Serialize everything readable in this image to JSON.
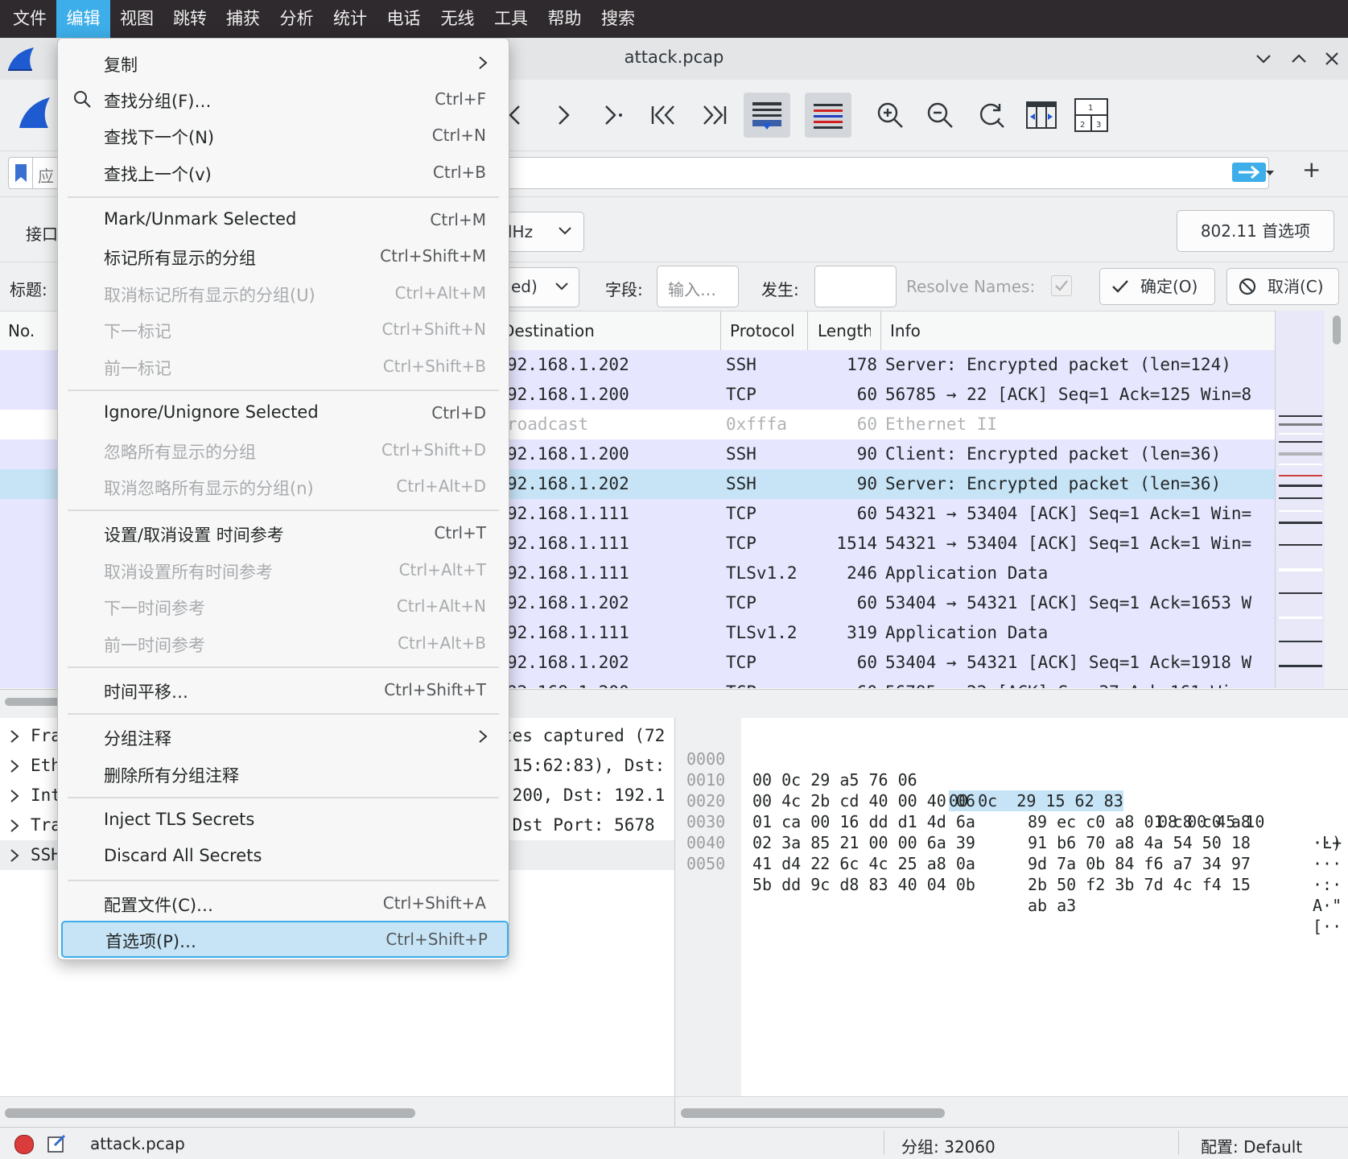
{
  "menubar": {
    "items": [
      "文件",
      "编辑",
      "视图",
      "跳转",
      "捕获",
      "分析",
      "统计",
      "电话",
      "无线",
      "工具",
      "帮助",
      "搜索"
    ]
  },
  "window": {
    "title": "attack.pcap"
  },
  "filter": {
    "left_label": "应"
  },
  "wireless": {
    "left_label": "接口",
    "channel_value": "lHz",
    "prefs_button": "802.11 首选项"
  },
  "column_prefs": {
    "title_label": "标题:",
    "type_value": "ed)",
    "field_label": "字段:",
    "field_placeholder": "输入…",
    "occurrence_label": "发生:",
    "resolve_label": "Resolve Names:",
    "ok_label": "确定(O)",
    "cancel_label": "取消(C)"
  },
  "packet_list": {
    "columns": {
      "no": "No.",
      "destination": "Destination",
      "protocol": "Protocol",
      "length": "Length",
      "info": "Info"
    },
    "rows": [
      {
        "dest": "92.168.1.202",
        "proto": "SSH",
        "len": "178",
        "info": "Server: Encrypted packet (len=124)"
      },
      {
        "dest": "92.168.1.200",
        "proto": "TCP",
        "len": "60",
        "info": "56785 → 22 [ACK] Seq=1 Ack=125 Win=8"
      },
      {
        "dest": "roadcast",
        "proto": "0xfffa",
        "len": "60",
        "info": "Ethernet II"
      },
      {
        "dest": "92.168.1.200",
        "proto": "SSH",
        "len": "90",
        "info": "Client: Encrypted packet (len=36)"
      },
      {
        "dest": "92.168.1.202",
        "proto": "SSH",
        "len": "90",
        "info": "Server: Encrypted packet (len=36)"
      },
      {
        "dest": "92.168.1.111",
        "proto": "TCP",
        "len": "60",
        "info": "54321 → 53404 [ACK] Seq=1 Ack=1 Win="
      },
      {
        "dest": "92.168.1.111",
        "proto": "TCP",
        "len": "1514",
        "info": "54321 → 53404 [ACK] Seq=1 Ack=1 Win="
      },
      {
        "dest": "92.168.1.111",
        "proto": "TLSv1.2",
        "len": "246",
        "info": "Application Data"
      },
      {
        "dest": "92.168.1.202",
        "proto": "TCP",
        "len": "60",
        "info": "53404 → 54321 [ACK] Seq=1 Ack=1653 W"
      },
      {
        "dest": "92.168.1.111",
        "proto": "TLSv1.2",
        "len": "319",
        "info": "Application Data"
      },
      {
        "dest": "92.168.1.202",
        "proto": "TCP",
        "len": "60",
        "info": "53404 → 54321 [ACK] Seq=1 Ack=1918 W"
      },
      {
        "dest": "92.168.1.200",
        "proto": "TCP",
        "len": "60",
        "info": "56785 → 22 [ACK] Seq=37 Ack=161 Win="
      }
    ]
  },
  "details": {
    "rows": [
      {
        "label": "Fra",
        "tail": "tes captured (72"
      },
      {
        "label": "Eth",
        "tail": ":15:62:83), Dst:"
      },
      {
        "label": "Int",
        "tail": ".200, Dst: 192.1"
      },
      {
        "label": "Tra",
        "tail": " Dst Port: 5678"
      },
      {
        "label": "SSH",
        "tail": ""
      }
    ]
  },
  "bytes": {
    "rows": [
      {
        "offset": "0000",
        "hex_a": "00 0c 29 a5 76 06",
        "hex_sel": "00 0c  29 15 62 83",
        "hex_b": "08 00 45 10",
        "ascii": "··)"
      },
      {
        "offset": "0010",
        "hex_a": "00 4c 2b cd 40 00 40 06",
        "hex_sel": "",
        "hex_b": "89 ec c0 a8 01 c8 c0 a8",
        "ascii": "·L+"
      },
      {
        "offset": "0020",
        "hex_a": "01 ca 00 16 dd d1 4d 6a",
        "hex_sel": "",
        "hex_b": "91 b6 70 a8 4a 54 50 18",
        "ascii": "···"
      },
      {
        "offset": "0030",
        "hex_a": "02 3a 85 21 00 00 6a 39",
        "hex_sel": "",
        "hex_b": "9d 7a 0b 84 f6 a7 34 97",
        "ascii": "·:·"
      },
      {
        "offset": "0040",
        "hex_a": "41 d4 22 6c 4c 25 a8 0a",
        "hex_sel": "",
        "hex_b": "2b 50 f2 3b 7d 4c f4 15",
        "ascii": "A·\""
      },
      {
        "offset": "0050",
        "hex_a": "5b dd 9c d8 83 40 04 0b",
        "hex_sel": "",
        "hex_b": "ab a3",
        "ascii": "[··"
      }
    ]
  },
  "status": {
    "file": "attack.pcap",
    "packets": "分组: 32060",
    "profile": "配置: Default"
  },
  "edit_menu": {
    "copy": "复制",
    "find_packet": "查找分组(F)…",
    "find_packet_sc": "Ctrl+F",
    "find_next": "查找下一个(N)",
    "find_next_sc": "Ctrl+N",
    "find_prev": "查找上一个(v)",
    "find_prev_sc": "Ctrl+B",
    "mark": "Mark/Unmark Selected",
    "mark_sc": "Ctrl+M",
    "mark_all": "标记所有显示的分组",
    "mark_all_sc": "Ctrl+Shift+M",
    "unmark_all": "取消标记所有显示的分组(U)",
    "unmark_all_sc": "Ctrl+Alt+M",
    "next_mark": "下一标记",
    "next_mark_sc": "Ctrl+Shift+N",
    "prev_mark": "前一标记",
    "prev_mark_sc": "Ctrl+Shift+B",
    "ignore": "Ignore/Unignore Selected",
    "ignore_sc": "Ctrl+D",
    "ignore_all": "忽略所有显示的分组",
    "ignore_all_sc": "Ctrl+Shift+D",
    "unignore_all": "取消忽略所有显示的分组(n)",
    "unignore_all_sc": "Ctrl+Alt+D",
    "time_ref": "设置/取消设置 时间参考",
    "time_ref_sc": "Ctrl+T",
    "unset_time_refs": "取消设置所有时间参考",
    "unset_time_refs_sc": "Ctrl+Alt+T",
    "next_time_ref": "下一时间参考",
    "next_time_ref_sc": "Ctrl+Alt+N",
    "prev_time_ref": "前一时间参考",
    "prev_time_ref_sc": "Ctrl+Alt+B",
    "time_shift": "时间平移…",
    "time_shift_sc": "Ctrl+Shift+T",
    "comment": "分组注释",
    "delete_comments": "删除所有分组注释",
    "inject_tls": "Inject TLS Secrets",
    "discard_secrets": "Discard All Secrets",
    "profiles": "配置文件(C)…",
    "profiles_sc": "Ctrl+Shift+A",
    "preferences": "首选项(P)…",
    "preferences_sc": "Ctrl+Shift+P"
  },
  "colors": {
    "accent": "#3daee9",
    "row_ssh_tcp": "#e7e6ff",
    "row_selected": "#c6e4f6"
  }
}
